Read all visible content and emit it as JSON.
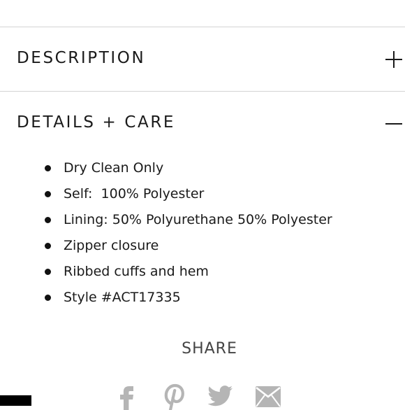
{
  "sections": {
    "description": {
      "title": "DESCRIPTION",
      "state_icon": "plus-icon"
    },
    "details": {
      "title": "DETAILS + CARE",
      "state_icon": "minus-icon",
      "items": [
        "Dry Clean Only",
        "Self:  100% Polyester",
        "Lining: 50% Polyurethane 50% Polyester",
        "Zipper closure",
        "Ribbed cuffs and hem",
        "Style #ACT17335"
      ]
    }
  },
  "share": {
    "label": "SHARE",
    "icons": [
      "facebook-icon",
      "pinterest-icon",
      "twitter-icon",
      "email-icon"
    ],
    "icon_color": "#b5b5b5"
  },
  "colors": {
    "text": "#1a1a1a",
    "divider": "#d4d4d4",
    "share_text": "#444444"
  }
}
